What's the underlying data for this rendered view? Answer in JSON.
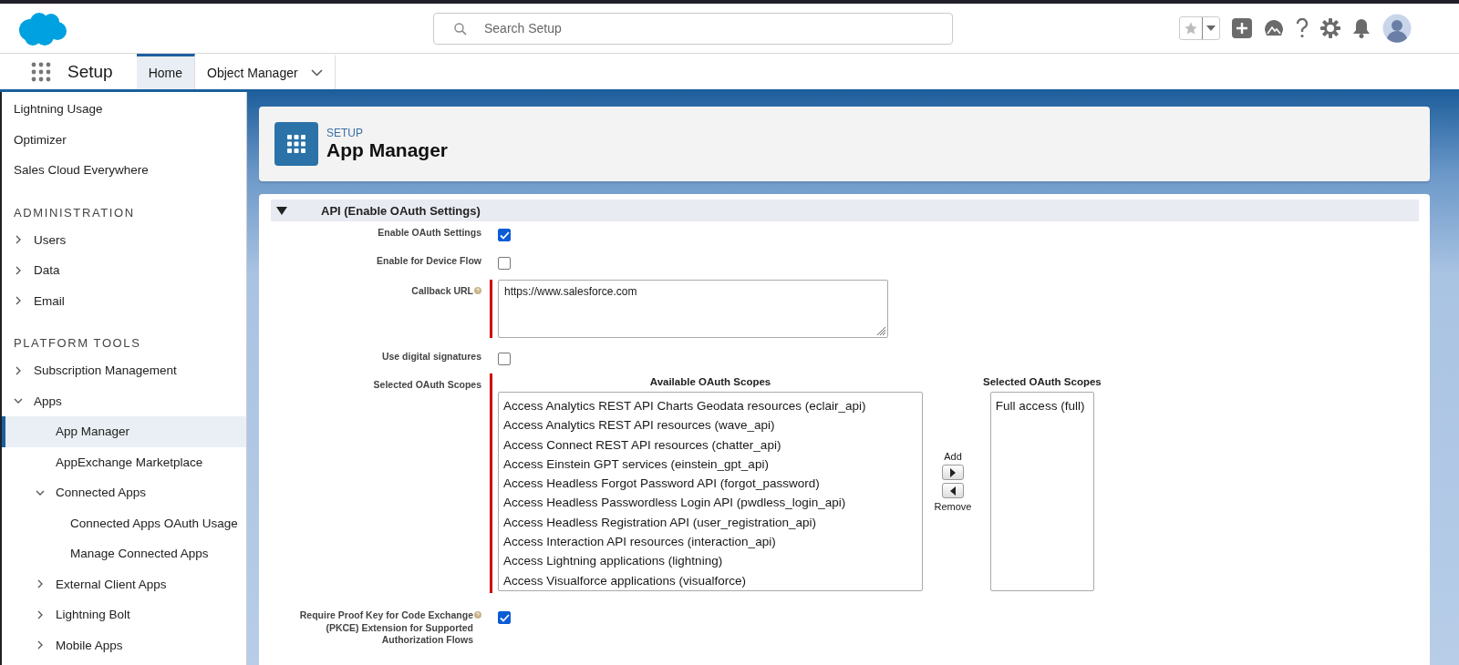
{
  "header": {
    "search": {
      "placeholder": "Search Setup"
    }
  },
  "nav": {
    "app_name": "Setup",
    "tabs": [
      {
        "label": "Home",
        "selected": true,
        "dropdown": false
      },
      {
        "label": "Object Manager",
        "selected": false,
        "dropdown": true
      }
    ]
  },
  "sidebar": {
    "top_links": [
      {
        "label": "Lightning Usage",
        "selected": false
      },
      {
        "label": "Optimizer",
        "selected": false
      },
      {
        "label": "Sales Cloud Everywhere",
        "selected": false
      }
    ],
    "sections": [
      {
        "title": "ADMINISTRATION",
        "items": [
          {
            "kind": "group",
            "label": "Users",
            "expanded": false,
            "selected": false
          },
          {
            "kind": "group",
            "label": "Data",
            "expanded": false,
            "selected": false
          },
          {
            "kind": "group",
            "label": "Email",
            "expanded": false,
            "selected": false
          }
        ]
      },
      {
        "title": "PLATFORM TOOLS",
        "items": [
          {
            "kind": "group",
            "label": "Subscription Management",
            "expanded": false,
            "selected": false
          },
          {
            "kind": "group",
            "label": "Apps",
            "expanded": true,
            "selected": false,
            "children": [
              {
                "kind": "link",
                "label": "App Manager",
                "selected": true
              },
              {
                "kind": "link",
                "label": "AppExchange Marketplace",
                "selected": false
              },
              {
                "kind": "group",
                "label": "Connected Apps",
                "expanded": true,
                "selected": false,
                "children": [
                  {
                    "label": "Connected Apps OAuth Usage",
                    "selected": false
                  },
                  {
                    "label": "Manage Connected Apps",
                    "selected": false
                  }
                ]
              },
              {
                "kind": "group",
                "label": "External Client Apps",
                "expanded": false,
                "selected": false
              },
              {
                "kind": "group",
                "label": "Lightning Bolt",
                "expanded": false,
                "selected": false
              },
              {
                "kind": "group",
                "label": "Mobile Apps",
                "expanded": false,
                "selected": false
              }
            ]
          }
        ]
      }
    ]
  },
  "page_header": {
    "eyebrow": "SETUP",
    "title": "App Manager"
  },
  "section": {
    "title": "API (Enable OAuth Settings)",
    "expanded": true,
    "fields": [
      {
        "kind": "checkbox",
        "label": "Enable OAuth Settings",
        "checked": true,
        "required": false,
        "help": false
      },
      {
        "kind": "checkbox",
        "label": "Enable for Device Flow",
        "checked": false,
        "required": false,
        "help": false
      },
      {
        "kind": "textarea",
        "label": "Callback URL",
        "value": "https://www.salesforce.com",
        "required": true,
        "help": true
      },
      {
        "kind": "checkbox",
        "label": "Use digital signatures",
        "checked": false,
        "required": false,
        "help": false
      },
      {
        "kind": "scopes",
        "label": "Selected OAuth Scopes",
        "required": true,
        "help": false,
        "available_title": "Available OAuth Scopes",
        "selected_title": "Selected OAuth Scopes",
        "add_label": "Add",
        "remove_label": "Remove",
        "available": [
          "Access Analytics REST API Charts Geodata resources (eclair_api)",
          "Access Analytics REST API resources (wave_api)",
          "Access Connect REST API resources (chatter_api)",
          "Access Einstein GPT services (einstein_gpt_api)",
          "Access Headless Forgot Password API (forgot_password)",
          "Access Headless Passwordless Login API (pwdless_login_api)",
          "Access Headless Registration API (user_registration_api)",
          "Access Interaction API resources (interaction_api)",
          "Access Lightning applications (lightning)",
          "Access Visualforce applications (visualforce)"
        ],
        "selected": [
          "Full access (full)"
        ]
      },
      {
        "kind": "checkbox",
        "label": "Require Proof Key for Code Exchange (PKCE) Extension for Supported Authorization Flows",
        "checked": true,
        "required": false,
        "help": true
      }
    ]
  }
}
